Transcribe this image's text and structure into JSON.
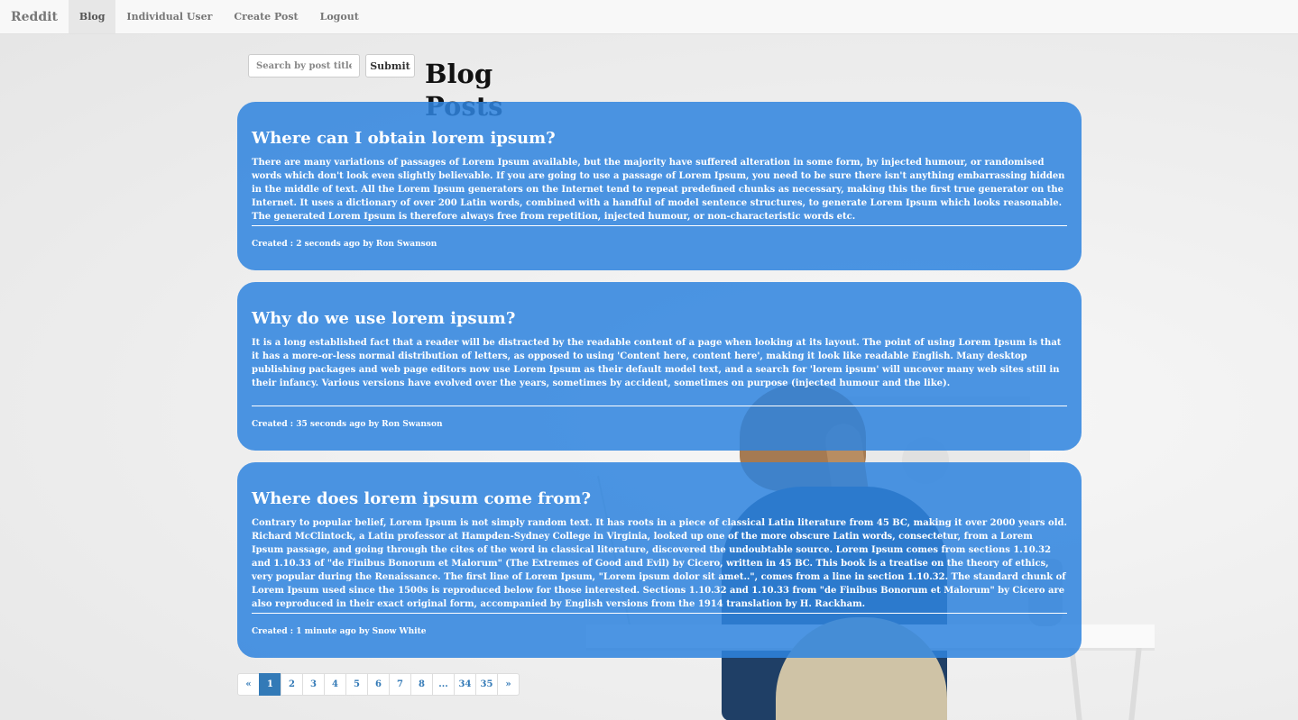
{
  "navbar": {
    "brand": "Reddit",
    "items": [
      {
        "label": "Blog",
        "active": true
      },
      {
        "label": "Individual User",
        "active": false
      },
      {
        "label": "Create Post",
        "active": false
      },
      {
        "label": "Logout",
        "active": false
      }
    ]
  },
  "search": {
    "placeholder": "Search by post title",
    "value": "",
    "submit_label": "Submit"
  },
  "page_title": "Blog Posts",
  "posts": [
    {
      "title": "Where can I obtain lorem ipsum?",
      "body": "There are many variations of passages of Lorem Ipsum available, but the majority have suffered alteration in some form, by injected humour, or randomised words which don't look even slightly believable. If you are going to use a passage of Lorem Ipsum, you need to be sure there isn't anything embarrassing hidden in the middle of text. All the Lorem Ipsum generators on the Internet tend to repeat predefined chunks as necessary, making this the first true generator on the Internet. It uses a dictionary of over 200 Latin words, combined with a handful of model sentence structures, to generate Lorem Ipsum which looks reasonable. The generated Lorem Ipsum is therefore always free from repetition, injected humour, or non-characteristic words etc.",
      "meta": "Created : 2 seconds ago by Ron Swanson"
    },
    {
      "title": "Why do we use lorem ipsum?",
      "body": "It is a long established fact that a reader will be distracted by the readable content of a page when looking at its layout. The point of using Lorem Ipsum is that it has a more-or-less normal distribution of letters, as opposed to using 'Content here, content here', making it look like readable English. Many desktop publishing packages and web page editors now use Lorem Ipsum as their default model text, and a search for 'lorem ipsum' will uncover many web sites still in their infancy. Various versions have evolved over the years, sometimes by accident, sometimes on purpose (injected humour and the like).",
      "meta": "Created : 35 seconds ago by Ron Swanson"
    },
    {
      "title": "Where does lorem ipsum come from?",
      "body": "Contrary to popular belief, Lorem Ipsum is not simply random text. It has roots in a piece of classical Latin literature from 45 BC, making it over 2000 years old. Richard McClintock, a Latin professor at Hampden-Sydney College in Virginia, looked up one of the more obscure Latin words, consectetur, from a Lorem Ipsum passage, and going through the cites of the word in classical literature, discovered the undoubtable source. Lorem Ipsum comes from sections 1.10.32 and 1.10.33 of \"de Finibus Bonorum et Malorum\" (The Extremes of Good and Evil) by Cicero, written in 45 BC. This book is a treatise on the theory of ethics, very popular during the Renaissance. The first line of Lorem Ipsum, \"Lorem ipsum dolor sit amet..\", comes from a line in section 1.10.32. The standard chunk of Lorem Ipsum used since the 1500s is reproduced below for those interested. Sections 1.10.32 and 1.10.33 from \"de Finibus Bonorum et Malorum\" by Cicero are also reproduced in their exact original form, accompanied by English versions from the 1914 translation by H. Rackham.",
      "meta": "Created : 1 minute ago by Snow White"
    }
  ],
  "pagination": {
    "prev": "«",
    "pages": [
      "1",
      "2",
      "3",
      "4",
      "5",
      "6",
      "7",
      "8",
      "...",
      "34",
      "35"
    ],
    "current": "1",
    "next": "»"
  },
  "colors": {
    "post_background": "#2e83de",
    "pagination_active": "#337ab7",
    "navbar_background": "#f8f8f8"
  }
}
